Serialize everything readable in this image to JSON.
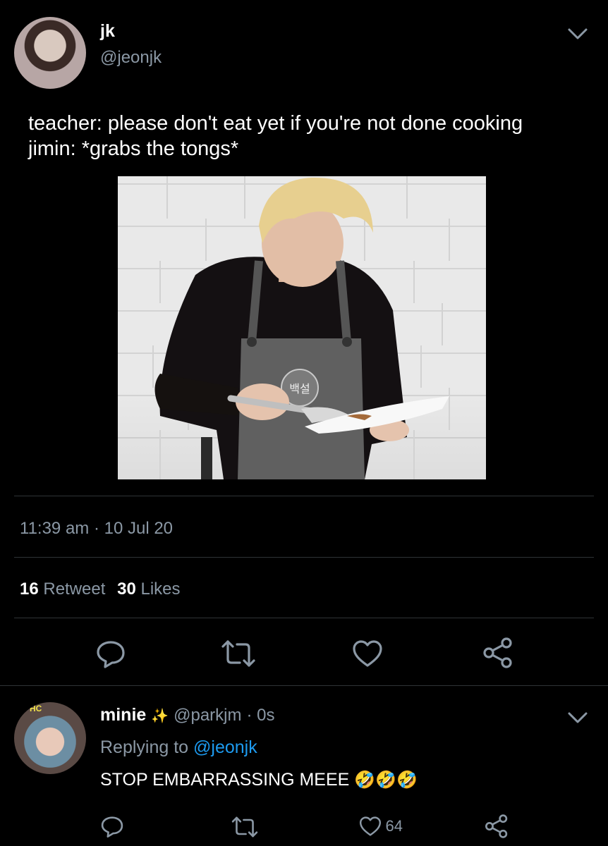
{
  "tweet": {
    "author_name": "jk",
    "author_handle": "@jeonjk",
    "text_line1": "teacher: please don't eat yet if you're not done cooking",
    "text_line2": "jimin: *grabs the tongs*",
    "timestamp": "11:39 am · 10 Jul 20",
    "retweet_count": "16",
    "retweet_label": "Retweet",
    "like_count": "30",
    "like_label": "Likes",
    "photo_stamp_text": "백설"
  },
  "reply": {
    "author_name": "minie",
    "author_handle": "@parkjm",
    "time": "· 0s",
    "replying_prefix": "Replying to",
    "replying_handle": "@jeonjk",
    "text": "STOP EMBARRASSING MEEE",
    "like_count": "64",
    "emoji": "🤣🤣🤣",
    "sparkle": "✨",
    "avatar_badge": "HC"
  },
  "icons": [
    "chevron-down-icon",
    "reply-icon",
    "retweet-icon",
    "heart-icon",
    "share-icon"
  ],
  "colors": {
    "background": "#000000",
    "muted": "#8b98a5",
    "link": "#1d9bf0",
    "divider": "#2f3336"
  }
}
